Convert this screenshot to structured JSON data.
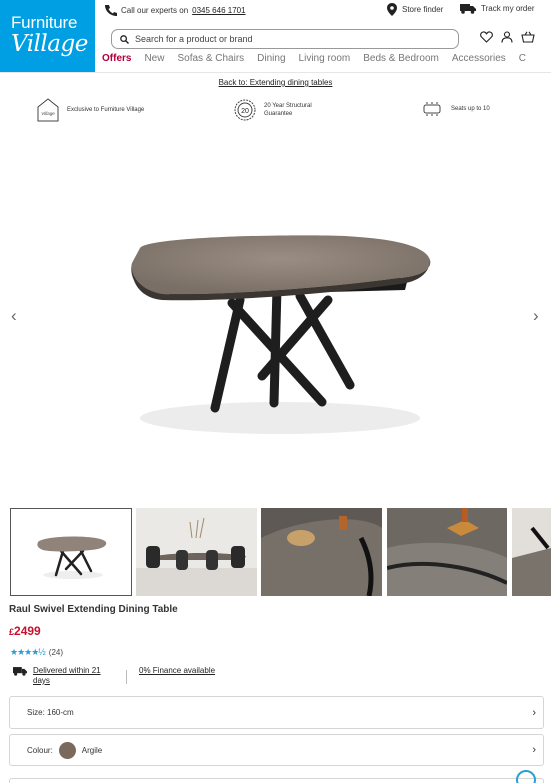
{
  "brand": {
    "line1": "Furniture",
    "line2": "Village",
    "color": "#009fe3"
  },
  "topbar": {
    "call_prefix": "Call our experts on",
    "phone": "0345 646 1701",
    "store_finder": "Store finder",
    "track_order": "Track my order"
  },
  "search": {
    "placeholder": "Search for a product or brand"
  },
  "nav": {
    "items": [
      "Offers",
      "New",
      "Sofas & Chairs",
      "Dining",
      "Living room",
      "Beds & Bedroom",
      "Accessories",
      "C"
    ]
  },
  "breadcrumb": {
    "back": "Back to: Extending dining tables"
  },
  "usps": [
    {
      "icon": "exclusive-badge-icon",
      "text": "Exclusive to Furniture Village"
    },
    {
      "icon": "20-year-guarantee-icon",
      "badge": "20",
      "text": "20 Year Structural Guarantee"
    },
    {
      "icon": "table-seats-icon",
      "text": "Seats up to 10"
    }
  ],
  "gallery": {
    "prev": "‹",
    "next": "›",
    "thumbnail_count": 5
  },
  "product": {
    "title": "Raul Swivel Extending Dining Table",
    "currency": "£",
    "price": "2499",
    "rating": 4.5,
    "stars": "★★★★½",
    "reviews": "(24)"
  },
  "delivery": {
    "text": "Delivered within 21 days"
  },
  "finance": {
    "text": "0% Finance available"
  },
  "options": {
    "size": "Size: 160-cm",
    "colour_label": "Colour:",
    "colour_value": "Argile",
    "swatch_color": "#7a6a5e"
  },
  "colors": {
    "accent": "#c8102e",
    "nav_active": "#b0003a",
    "stars": "#2a9fd6"
  }
}
